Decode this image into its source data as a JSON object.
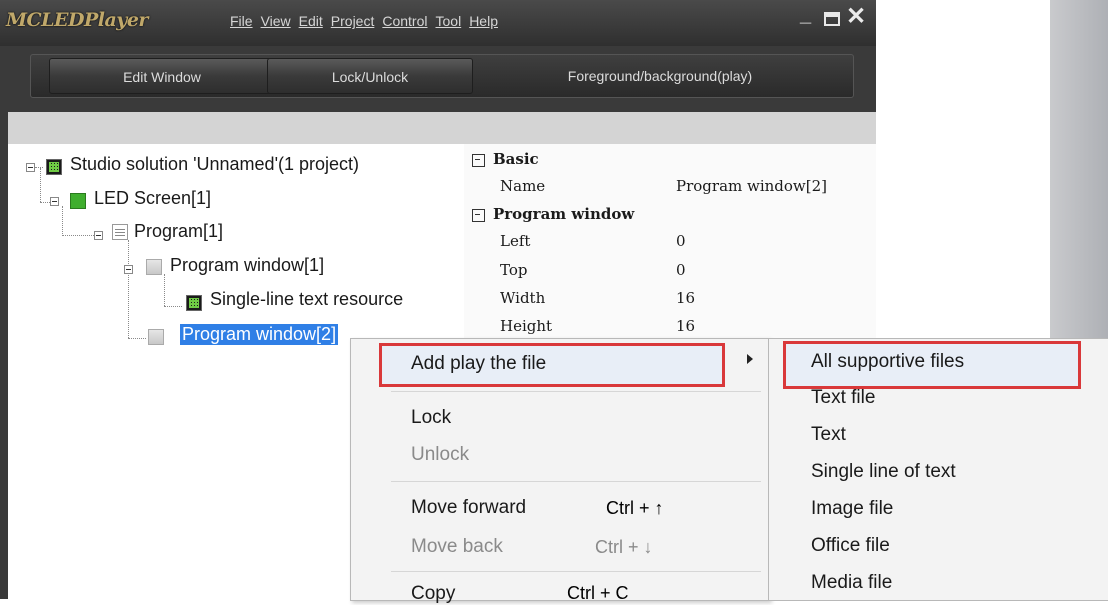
{
  "app": {
    "logo": "MCLEDPlayer",
    "menu": [
      "File",
      "View",
      "Edit",
      "Project",
      "Control",
      "Tool",
      "Help"
    ],
    "window_controls": {
      "minimize": "_",
      "close": "✕"
    }
  },
  "toolbar": {
    "edit_window": "Edit Window",
    "lock_unlock": "Lock/Unlock",
    "foreground": "Foreground/background(play)"
  },
  "tree": {
    "solution": "Studio solution 'Unnamed'(1 project)",
    "screen": "LED Screen[1]",
    "program": "Program[1]",
    "window1": "Program window[1]",
    "resource": "Single-line text resource",
    "window2": "Program window[2]"
  },
  "properties": {
    "basic_label": "Basic",
    "name_label": "Name",
    "name_value": "Program window[2]",
    "program_window_label": "Program window",
    "left_label": "Left",
    "left_value": "0",
    "top_label": "Top",
    "top_value": "0",
    "width_label": "Width",
    "width_value": "16",
    "height_label": "Height",
    "height_value": "16"
  },
  "context_menu": {
    "add_play": "Add play the file",
    "lock": "Lock",
    "unlock": "Unlock",
    "move_forward": "Move forward",
    "move_forward_shortcut": "Ctrl + ↑",
    "move_back": "Move back",
    "move_back_shortcut": "Ctrl + ↓",
    "copy": "Copy",
    "copy_shortcut": "Ctrl + C"
  },
  "submenu": {
    "all": "All supportive files",
    "text_file": "Text file",
    "text": "Text",
    "single_line": "Single line of text",
    "image": "Image file",
    "office": "Office file",
    "media": "Media file"
  },
  "colors": {
    "highlight_border": "#d9383a",
    "selection": "#2f7fe6"
  }
}
